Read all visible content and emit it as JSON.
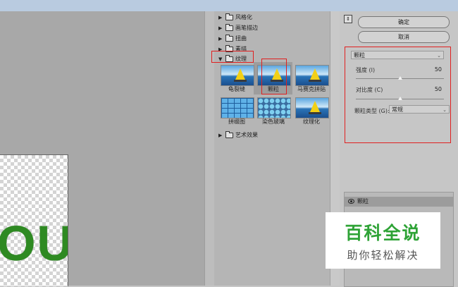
{
  "filter_gallery": {
    "categories": [
      {
        "label": "风格化",
        "expanded": false
      },
      {
        "label": "画笔描边",
        "expanded": false
      },
      {
        "label": "扭曲",
        "expanded": false
      },
      {
        "label": "素描",
        "expanded": false
      },
      {
        "label": "纹理",
        "expanded": true
      },
      {
        "label": "艺术效果",
        "expanded": false
      }
    ],
    "texture_filters": [
      {
        "label": "龟裂缝"
      },
      {
        "label": "颗粒",
        "selected": true
      },
      {
        "label": "马赛克拼贴"
      },
      {
        "label": "拼缀图"
      },
      {
        "label": "染色玻璃"
      },
      {
        "label": "纹理化"
      }
    ]
  },
  "settings": {
    "ok_label": "确定",
    "cancel_label": "取消",
    "filter_select": "颗粒",
    "intensity": {
      "label": "强度 (I)",
      "value": "50",
      "fraction": 0.5
    },
    "contrast": {
      "label": "对比度 (C)",
      "value": "50",
      "fraction": 0.5
    },
    "grain_type": {
      "label": "颗粒类型 (G):",
      "value": "常规"
    }
  },
  "layers": {
    "items": [
      {
        "label": "颗粒"
      }
    ]
  },
  "canvas": {
    "text": "OU"
  },
  "watermark": {
    "title": "百科全说",
    "subtitle": "助你轻松解决"
  },
  "colors": {
    "highlight": "#e02020",
    "watermark_green": "#2ea336",
    "text_green": "#2e8a22"
  }
}
